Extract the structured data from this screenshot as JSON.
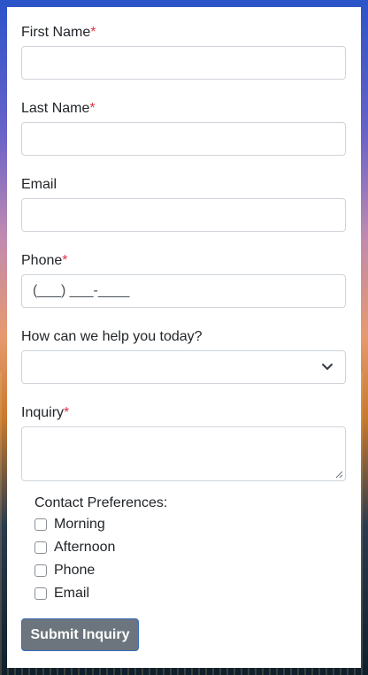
{
  "form": {
    "first_name": {
      "label": "First Name",
      "required_mark": "*",
      "value": ""
    },
    "last_name": {
      "label": "Last Name",
      "required_mark": "*",
      "value": ""
    },
    "email": {
      "label": "Email",
      "value": ""
    },
    "phone": {
      "label": "Phone",
      "required_mark": "*",
      "placeholder": "(___) ___-____"
    },
    "help": {
      "label": "How can we help you today?",
      "selected": ""
    },
    "inquiry": {
      "label": "Inquiry",
      "required_mark": "*",
      "value": ""
    },
    "preferences": {
      "title": "Contact Preferences:",
      "options": [
        "Morning",
        "Afternoon",
        "Phone",
        "Email"
      ]
    },
    "submit_label": "Submit Inquiry"
  },
  "colors": {
    "required": "#dc3545",
    "button_bg": "#6c757d",
    "button_border": "#3569b8"
  },
  "icons": {
    "select_arrow": "chevron-down-icon",
    "resize": "resize-handle-icon"
  }
}
